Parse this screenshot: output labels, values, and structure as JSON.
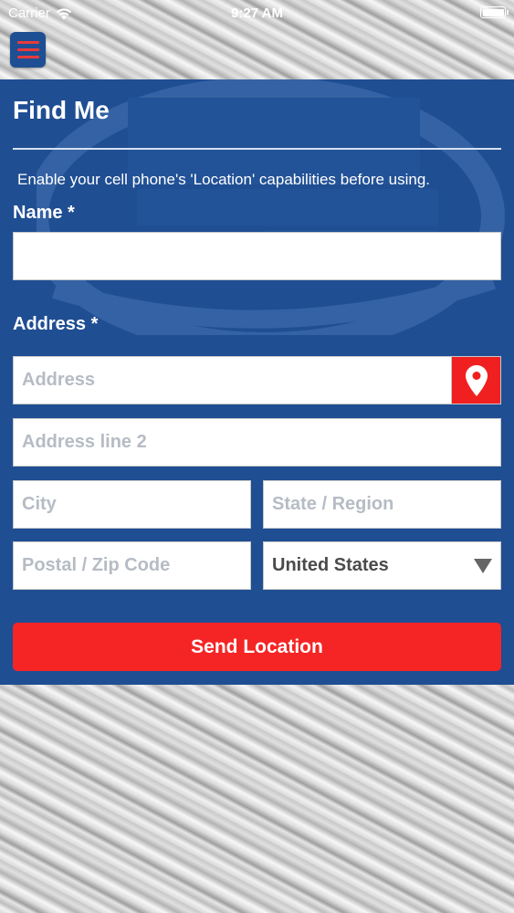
{
  "status_bar": {
    "carrier": "Carrier",
    "time": "9:27 AM"
  },
  "menu": {
    "icon": "hamburger-menu-icon"
  },
  "form": {
    "title": "Find Me",
    "notice": "Enable your cell phone's 'Location' capabilities before using.",
    "name_label": "Name *",
    "name_value": "",
    "address_label": "Address *",
    "address_placeholder": "Address",
    "address2_placeholder": "Address line 2",
    "city_placeholder": "City",
    "state_placeholder": "State / Region",
    "zip_placeholder": "Postal / Zip Code",
    "country_selected": "United States",
    "locate_icon": "map-pin-icon",
    "send_label": "Send Location"
  },
  "colors": {
    "panel": "#1f4e93",
    "accent_red": "#f52525",
    "text_white": "#ffffff"
  }
}
